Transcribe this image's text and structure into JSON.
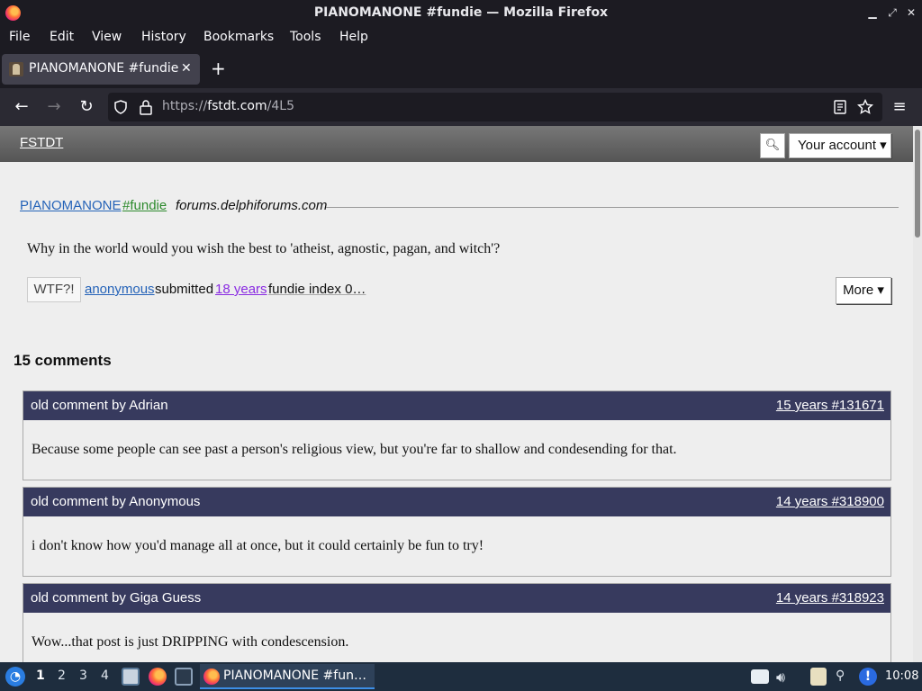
{
  "window": {
    "title": "PIANOMANONE #fundie — Mozilla Firefox"
  },
  "menu": [
    "File",
    "Edit",
    "View",
    "History",
    "Bookmarks",
    "Tools",
    "Help"
  ],
  "tab": {
    "title": "PIANOMANONE #fundie"
  },
  "address": {
    "prefix": "https://",
    "host": "fstdt.com",
    "path": "/4L5"
  },
  "site": {
    "logo": "FSTDT",
    "account_label": "Your account ▾"
  },
  "post": {
    "author": "PIANOMANONE",
    "tag": "#fundie",
    "source": "forums.delphiforums.com",
    "quote": "Why in the world would you wish the best to 'atheist, agnostic, pagan, and witch'?",
    "wtf_label": "WTF?!",
    "submitter": "anonymous",
    "submitted_text": "submitted",
    "age": "18 years",
    "fundie_index": "fundie index 0…",
    "more_label": "More ▾"
  },
  "comments_heading": "15 comments",
  "comments": [
    {
      "by": "old comment by Adrian",
      "ref": "15 years #131671",
      "text": "Because some people can see past a person's religious view, but you're far to shallow and condesending for that."
    },
    {
      "by": "old comment by Anonymous",
      "ref": "14 years #318900",
      "text": "i don't know how you'd manage all at once, but it could certainly be fun to try!"
    },
    {
      "by": "old comment by Giga Guess",
      "ref": "14 years #318923",
      "text": "Wow...that post is just DRIPPING with condescension."
    }
  ],
  "taskbar": {
    "workspaces": [
      "1",
      "2",
      "3",
      "4"
    ],
    "active_task": "PIANOMANONE #fun…",
    "clock": "10:08"
  },
  "colors": {
    "comment_header": "#373a5e",
    "link": "#2563b8",
    "tag": "#2d8a2d"
  }
}
